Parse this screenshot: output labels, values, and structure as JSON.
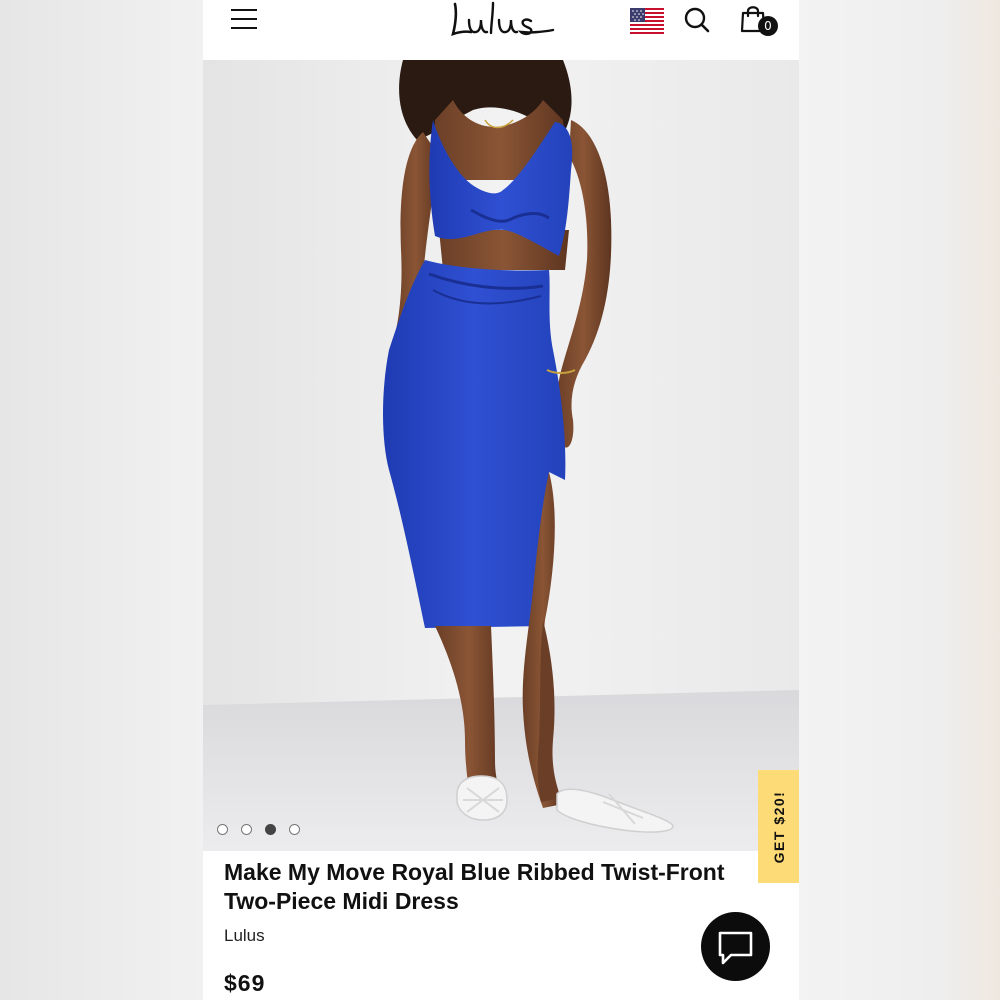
{
  "header": {
    "brand_logo": "Lulus",
    "menu_icon": "hamburger-menu-icon",
    "flag_icon": "us-flag-icon",
    "search_icon": "search-icon",
    "bag_icon": "shopping-bag-icon",
    "bag_count": "0"
  },
  "gallery": {
    "image_alt": "Model wearing royal blue ribbed twist-front two-piece midi dress",
    "dots": [
      {
        "state": "inactive"
      },
      {
        "state": "inactive"
      },
      {
        "state": "active"
      },
      {
        "state": "inactive"
      }
    ],
    "active_index": 2
  },
  "promo": {
    "label": "GET $20!"
  },
  "product": {
    "title_line1": "Make My Move Royal Blue Ribbed Twist-Front",
    "title_line2": "Two-Piece Midi Dress",
    "brand": "Lulus",
    "price": "$69"
  },
  "chat": {
    "icon": "chat-bubble-icon"
  },
  "colors": {
    "dress_blue": "#2a49c6",
    "promo_yellow": "#fddb77",
    "chat_black": "#0c0c0c"
  }
}
